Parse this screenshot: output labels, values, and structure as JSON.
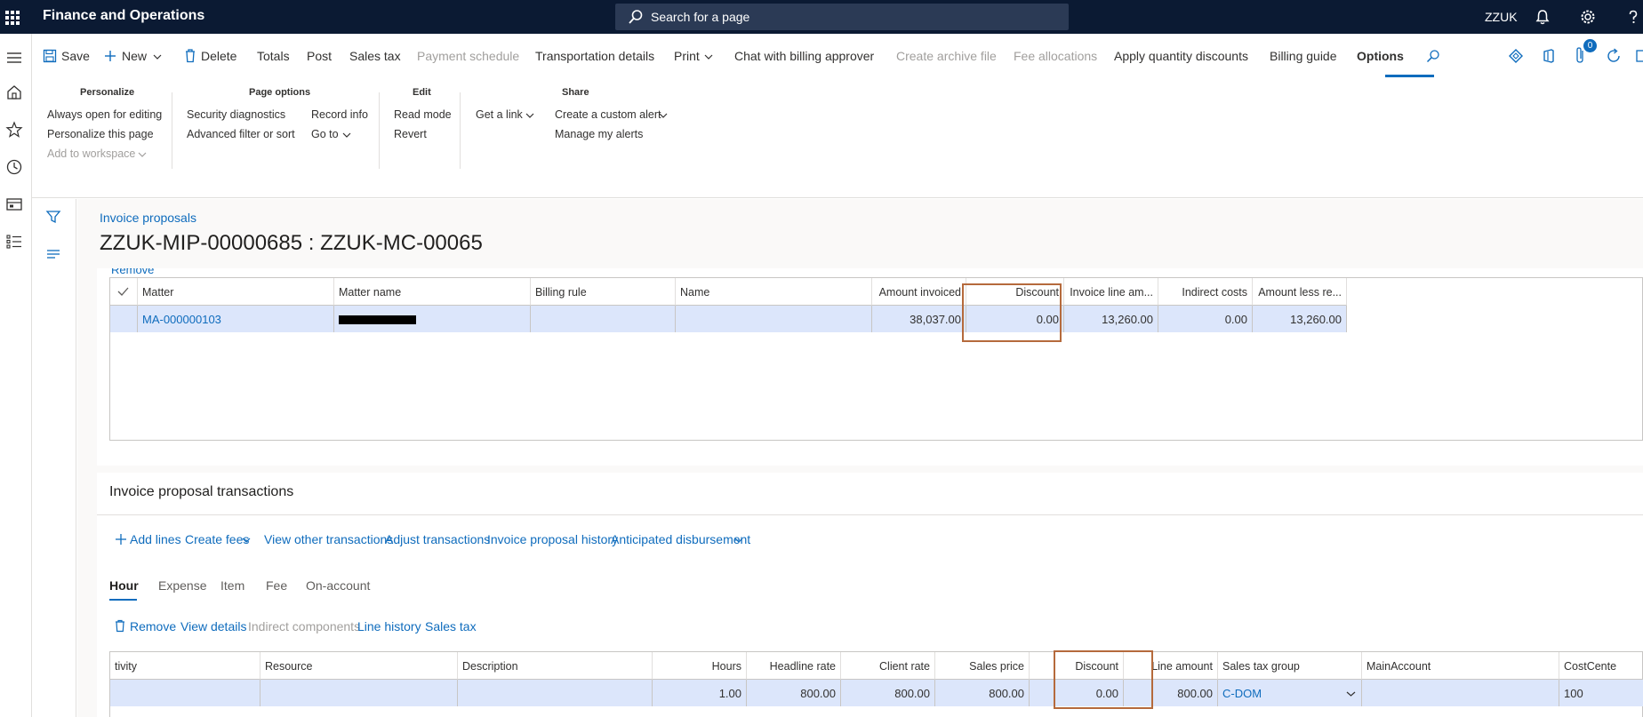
{
  "topbar": {
    "app_title": "Finance and Operations",
    "search_placeholder": "Search for a page",
    "company": "ZZUK"
  },
  "action_pane": {
    "save": "Save",
    "new": "New",
    "delete": "Delete",
    "totals": "Totals",
    "post": "Post",
    "sales_tax": "Sales tax",
    "payment_schedule": "Payment schedule",
    "transportation_details": "Transportation details",
    "print": "Print",
    "chat_with_billing_approver": "Chat with billing approver",
    "create_archive_file": "Create archive file",
    "fee_allocations": "Fee allocations",
    "apply_quantity_discounts": "Apply quantity discounts",
    "billing_guide": "Billing guide",
    "options": "Options",
    "notification_count": "0"
  },
  "ribbon": {
    "personalize": {
      "title": "Personalize",
      "always_open": "Always open for editing",
      "personalize_page": "Personalize this page",
      "add_to_workspace": "Add to workspace"
    },
    "page_options": {
      "title": "Page options",
      "security_diagnostics": "Security diagnostics",
      "advanced_filter": "Advanced filter or sort",
      "record_info": "Record info",
      "go_to": "Go to"
    },
    "edit": {
      "title": "Edit",
      "read_mode": "Read mode",
      "revert": "Revert"
    },
    "share": {
      "title": "Share",
      "get_a_link": "Get a link",
      "create_custom_alert": "Create a custom alert",
      "manage_alerts": "Manage my alerts"
    }
  },
  "page": {
    "breadcrumb": "Invoice proposals",
    "title": "ZZUK-MIP-00000685 : ZZUK-MC-00065",
    "partial_remove": "Remove"
  },
  "matter_grid": {
    "headers": {
      "matter": "Matter",
      "matter_name": "Matter name",
      "billing_rule": "Billing rule",
      "name": "Name",
      "amount_invoiced": "Amount invoiced",
      "discount": "Discount",
      "invoice_line_amount": "Invoice line am...",
      "indirect_costs": "Indirect costs",
      "amount_less": "Amount less re..."
    },
    "row": {
      "matter": "MA-000000103",
      "matter_name": "",
      "billing_rule": "",
      "name": "",
      "amount_invoiced": "38,037.00",
      "discount": "0.00",
      "invoice_line_amount": "13,260.00",
      "indirect_costs": "0.00",
      "amount_less": "13,260.00"
    }
  },
  "transactions": {
    "title": "Invoice proposal transactions",
    "toolbar": {
      "add_lines": "Add lines",
      "create_fees": "Create fees",
      "view_other": "View other transactions",
      "adjust": "Adjust transactions",
      "history": "Invoice proposal history",
      "anticipated": "Anticipated disbursement"
    },
    "tabs": [
      "Hour",
      "Expense",
      "Item",
      "Fee",
      "On-account"
    ],
    "line_toolbar": {
      "remove": "Remove",
      "view_details": "View details",
      "indirect_components": "Indirect components",
      "line_history": "Line history",
      "sales_tax": "Sales tax"
    },
    "headers": {
      "activity": "tivity",
      "resource": "Resource",
      "description": "Description",
      "hours": "Hours",
      "headline_rate": "Headline rate",
      "client_rate": "Client rate",
      "sales_price": "Sales price",
      "discount": "Discount",
      "line_amount": "Line amount",
      "sales_tax_group": "Sales tax group",
      "main_account": "MainAccount",
      "cost_center": "CostCente"
    },
    "row": {
      "hours": "1.00",
      "headline_rate": "800.00",
      "client_rate": "800.00",
      "sales_price": "800.00",
      "discount": "0.00",
      "line_amount": "800.00",
      "sales_tax_group": "C-DOM",
      "main_account": "",
      "cost_center": "100"
    }
  },
  "colors": {
    "topbar": "#0b1a33",
    "accent": "#0f6cbd",
    "selected_row": "#dce6fb",
    "highlight_box": "#b56a3c"
  }
}
